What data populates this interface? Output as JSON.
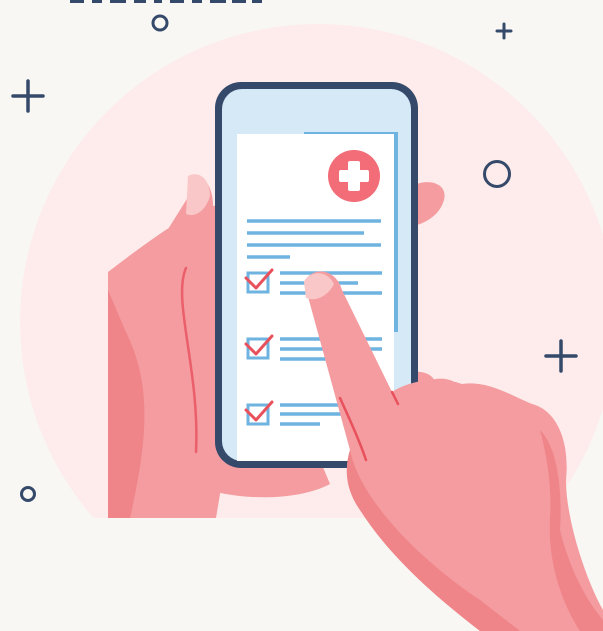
{
  "illustration": {
    "subject": "hand-holding-phone-medical-checklist",
    "colors": {
      "background": "#f8f7f3",
      "blob": "#fdeceb",
      "phone_frame": "#354a6b",
      "phone_screen": "#d5e9f7",
      "document": "#ffffff",
      "accent_blue": "#6fb3e0",
      "medical_badge": "#f26d78",
      "checkmark": "#e8515c",
      "skin": "#f49ca0",
      "skin_shadow": "#ef8489",
      "skin_light": "#f7b3b5",
      "fingernail": "#f9c7c7",
      "decorations": "#354a6b"
    },
    "icons": {
      "badge": "medical-cross-icon",
      "checkboxes": [
        "checkbox-checked-icon",
        "checkbox-checked-icon",
        "checkbox-checked-icon"
      ],
      "decorations": [
        "plus-icon",
        "circle-icon"
      ]
    },
    "checklist_items_checked": 3
  }
}
